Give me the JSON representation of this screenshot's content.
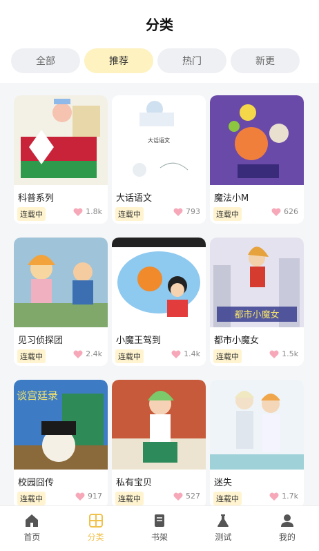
{
  "header": {
    "title": "分类"
  },
  "tabs": [
    {
      "label": "全部",
      "active": false
    },
    {
      "label": "推荐",
      "active": true
    },
    {
      "label": "热门",
      "active": false
    },
    {
      "label": "新更",
      "active": false
    }
  ],
  "comics": [
    {
      "title": "科普系列",
      "status": "连载中",
      "likes": "1.8k"
    },
    {
      "title": "大话语文",
      "status": "连载中",
      "likes": "793"
    },
    {
      "title": "魔法小M",
      "status": "连载中",
      "likes": "626"
    },
    {
      "title": "见习侦探团",
      "status": "连载中",
      "likes": "2.4k"
    },
    {
      "title": "小魔王驾到",
      "status": "连载中",
      "likes": "1.4k"
    },
    {
      "title": "都市小魔女",
      "status": "连载中",
      "likes": "1.5k"
    },
    {
      "title": "校园囧传",
      "status": "连载中",
      "likes": "917"
    },
    {
      "title": "私有宝贝",
      "status": "连载中",
      "likes": "527"
    },
    {
      "title": "迷失",
      "status": "连载中",
      "likes": "1.7k"
    }
  ],
  "covers": {
    "c2": "大话语文",
    "c6": "都市小魔女",
    "c7": "谈宫廷录"
  },
  "tabbar": [
    {
      "label": "首页",
      "icon": "home-icon",
      "active": false
    },
    {
      "label": "分类",
      "icon": "category-icon",
      "active": true
    },
    {
      "label": "书架",
      "icon": "bookshelf-icon",
      "active": false
    },
    {
      "label": "测试",
      "icon": "flask-icon",
      "active": false
    },
    {
      "label": "我的",
      "icon": "profile-icon",
      "active": false
    }
  ],
  "colors": {
    "accent": "#f0c14b",
    "active_tab_bg": "#fdf2c0",
    "status_bg": "#fff4cf",
    "heart": "#f7a8b8"
  }
}
